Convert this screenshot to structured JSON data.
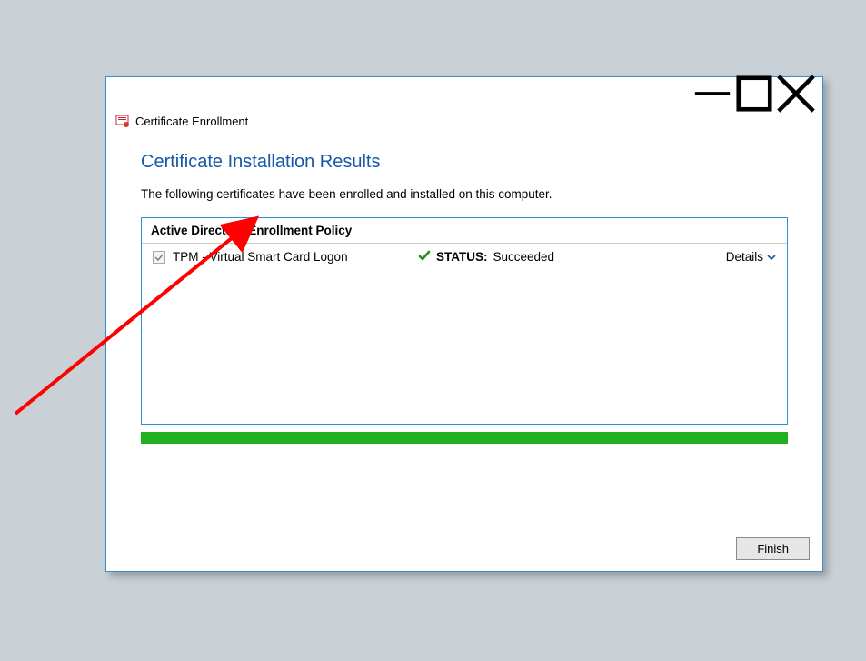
{
  "window": {
    "title": "Certificate Enrollment"
  },
  "page": {
    "heading": "Certificate Installation Results",
    "description": "The following certificates have been enrolled and installed on this computer."
  },
  "policy": {
    "header": "Active Directory Enrollment Policy",
    "cert_name": "TPM - Virtual Smart Card Logon",
    "status_label": "STATUS:",
    "status_value": "Succeeded",
    "details_label": "Details"
  },
  "buttons": {
    "finish": "Finish"
  },
  "colors": {
    "accent": "#2d90d6",
    "heading": "#1658a7",
    "progress": "#1fb11f",
    "annotation": "#ff0000"
  }
}
